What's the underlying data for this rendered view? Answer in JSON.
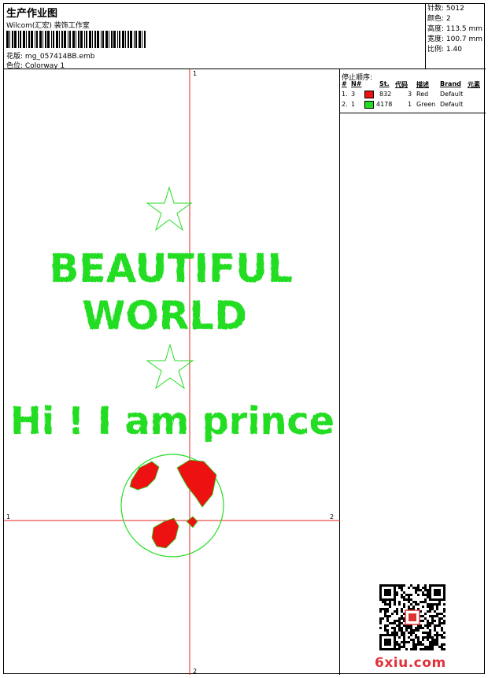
{
  "header": {
    "title": "生产作业图",
    "company": "Wilcom(汇宏) 装饰工作室",
    "pattern_label": "花版:",
    "pattern_value": "mg_057414BB.emb",
    "colorway_label": "色位:",
    "colorway_value": "Colorway 1"
  },
  "stats": {
    "stitches": "针数: 5012",
    "colors": "颜色: 2",
    "height": "高度: 113.5 mm",
    "width": "宽度: 100.7 mm",
    "scale": "比例: 1.40"
  },
  "canvas": {
    "text_line1": "BEAUTIFUL",
    "text_line2": "WORLD",
    "text_line3": "Hi ! I am prince",
    "axis_top": "1",
    "axis_bottom": "2",
    "axis_left": "1",
    "axis_right": "2",
    "colors": {
      "green": "#22dd22",
      "red": "#ee1111",
      "guide": "#ee2222"
    }
  },
  "stop_sequence": {
    "title": "停止顺序:",
    "headers": [
      "#",
      "N#",
      "St.",
      "代码",
      "描述",
      "Brand",
      "元素"
    ],
    "rows": [
      {
        "index": "1.",
        "n": "3",
        "stitches": "832",
        "code": "3",
        "name": "Red",
        "brand": "Default",
        "swatch": "#ee1111"
      },
      {
        "index": "2.",
        "n": "1",
        "stitches": "4178",
        "code": "1",
        "name": "Green",
        "brand": "Default",
        "swatch": "#22dd22"
      }
    ]
  },
  "watermark": "6xiu.com"
}
